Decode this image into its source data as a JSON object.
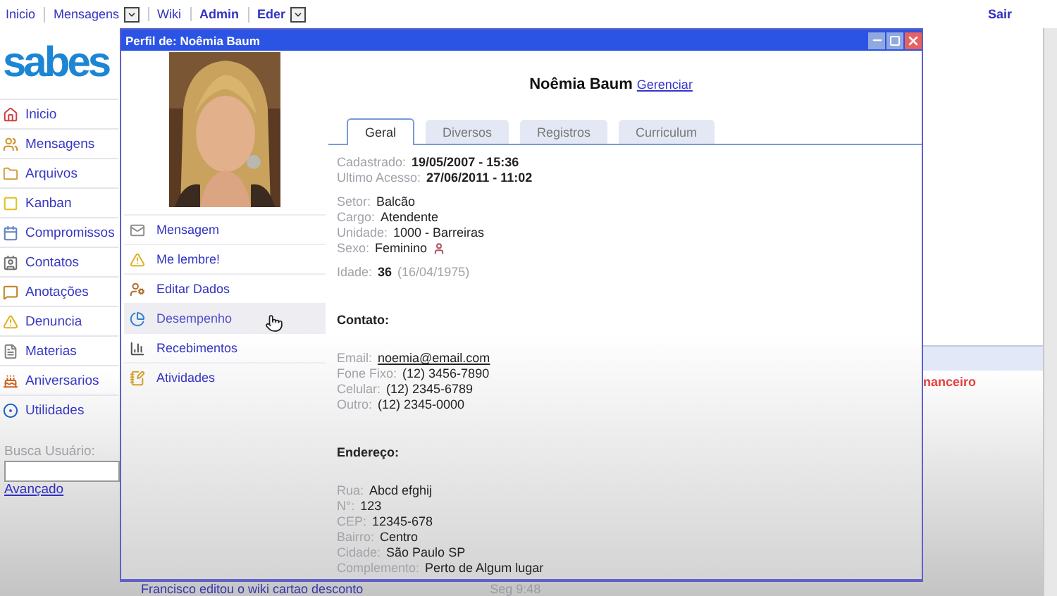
{
  "top_nav": {
    "items": [
      {
        "label": "Inicio",
        "bold": false,
        "dropdown": false
      },
      {
        "label": "Mensagens",
        "bold": false,
        "dropdown": true
      },
      {
        "label": "Wiki",
        "bold": false,
        "dropdown": false
      },
      {
        "label": "Admin",
        "bold": true,
        "dropdown": false
      },
      {
        "label": "Eder",
        "bold": true,
        "dropdown": true
      }
    ],
    "logout": "Sair"
  },
  "logo": "sabes",
  "sidebar": {
    "items": [
      {
        "label": "Inicio"
      },
      {
        "label": "Mensagens"
      },
      {
        "label": "Arquivos"
      },
      {
        "label": "Kanban"
      },
      {
        "label": "Compromissos"
      },
      {
        "label": "Contatos"
      },
      {
        "label": "Anotações"
      },
      {
        "label": "Denuncia"
      },
      {
        "label": "Materias"
      },
      {
        "label": "Aniversarios"
      },
      {
        "label": "Utilidades"
      }
    ],
    "search": {
      "label": "Busca Usuário:",
      "link": "Avançado"
    }
  },
  "background": {
    "alert_text": "nanceiro",
    "activity": {
      "text": "Francisco editou o wiki cartao desconto",
      "time": "Seg 9:48"
    }
  },
  "profile_window": {
    "title": "Perfil de: Noêmia Baum",
    "name": "Noêmia Baum",
    "manage_link": "Gerenciar",
    "menu": [
      {
        "label": "Mensagem",
        "highlighted": false
      },
      {
        "label": "Me lembre!",
        "highlighted": false
      },
      {
        "label": "Editar Dados",
        "highlighted": false
      },
      {
        "label": "Desempenho",
        "highlighted": true
      },
      {
        "label": "Recebimentos",
        "highlighted": false
      },
      {
        "label": "Atividades",
        "highlighted": false
      }
    ],
    "tabs": [
      {
        "label": "Geral",
        "selected": true
      },
      {
        "label": "Diversos",
        "selected": false
      },
      {
        "label": "Registros",
        "selected": false
      },
      {
        "label": "Curriculum",
        "selected": false
      }
    ],
    "sections": [
      {
        "groups": [
          [
            {
              "label": "Cadastrado:",
              "value": "19/05/2007 - 15:36",
              "kind": "bold"
            },
            {
              "label": "Ultimo Acesso:",
              "value": "27/06/2011 - 11:02",
              "kind": "bold"
            }
          ],
          [
            {
              "label": "Setor:",
              "value": "Balcão",
              "kind": "text"
            },
            {
              "label": "Cargo:",
              "value": "Atendente",
              "kind": "text"
            },
            {
              "label": "Unidade:",
              "value": "1000 - Barreiras",
              "kind": "text"
            },
            {
              "label": "Sexo:",
              "value": "Feminino",
              "kind": "with_icon"
            }
          ],
          [
            {
              "label": "Idade:",
              "value": "36",
              "note": "(16/04/1975)",
              "kind": "bold"
            }
          ]
        ]
      },
      {
        "heading": "Contato:",
        "groups": [
          [
            {
              "label": "Email:",
              "value": "noemia@email.com",
              "kind": "link"
            },
            {
              "label": "Fone Fixo:",
              "value": "(12) 3456-7890",
              "kind": "text"
            },
            {
              "label": "Celular:",
              "value": "(12) 2345-6789",
              "kind": "text"
            },
            {
              "label": "Outro:",
              "value": "(12) 2345-0000",
              "kind": "text"
            }
          ]
        ]
      },
      {
        "heading": "Endereço:",
        "groups": [
          [
            {
              "label": "Rua:",
              "value": "Abcd efghij",
              "kind": "text"
            },
            {
              "label": "N°:",
              "value": "123",
              "kind": "text"
            },
            {
              "label": "CEP:",
              "value": "12345-678",
              "kind": "text"
            },
            {
              "label": "Bairro:",
              "value": "Centro",
              "kind": "text"
            },
            {
              "label": "Cidade:",
              "value": "São Paulo SP",
              "kind": "text"
            },
            {
              "label": "Complemento:",
              "value": "Perto de Algum lugar",
              "kind": "text"
            }
          ]
        ]
      }
    ]
  }
}
